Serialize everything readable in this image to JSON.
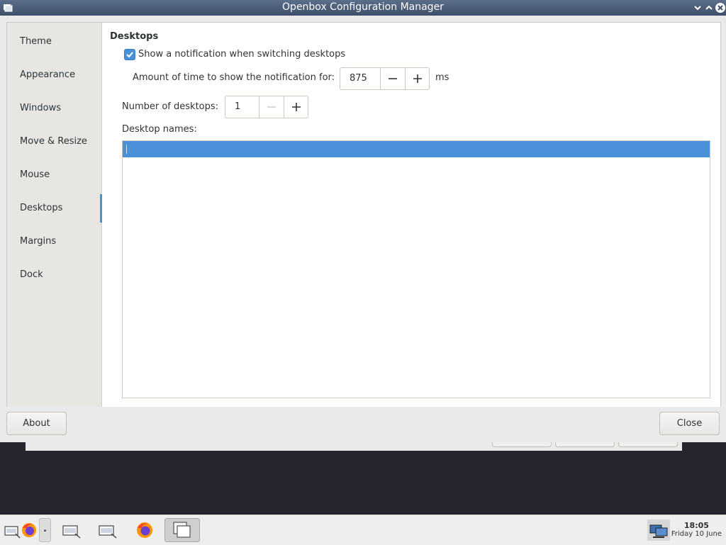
{
  "window": {
    "title": "Openbox Configuration Manager"
  },
  "sidebar": {
    "items": [
      {
        "label": "Theme"
      },
      {
        "label": "Appearance"
      },
      {
        "label": "Windows"
      },
      {
        "label": "Move & Resize"
      },
      {
        "label": "Mouse"
      },
      {
        "label": "Desktops",
        "active": true
      },
      {
        "label": "Margins"
      },
      {
        "label": "Dock"
      }
    ]
  },
  "desktops": {
    "section_title": "Desktops",
    "notify_checkbox": {
      "label": "Show a notification when switching desktops",
      "checked": true
    },
    "notify_time": {
      "label": "Amount of time to show the notification for:",
      "value": "875",
      "unit": "ms"
    },
    "num_desktops": {
      "label": "Number of desktops:",
      "value": "1"
    },
    "names_label": "Desktop names:"
  },
  "buttons": {
    "about": "About",
    "close": "Close"
  },
  "taskbar": {
    "time": "18:05",
    "date": "Friday 10 June",
    "pager_label": "."
  },
  "colors": {
    "accent": "#4a90d9",
    "titlebar": "#4b5b77"
  }
}
